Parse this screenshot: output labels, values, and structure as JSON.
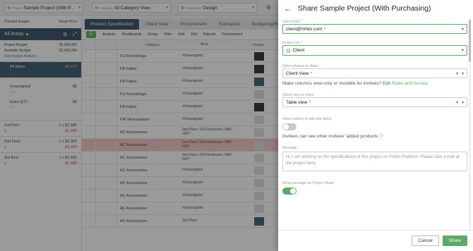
{
  "topbar": {
    "project_label": "Project",
    "project_value": "Sample Project (With P...",
    "category_label": "Category",
    "category_value": "All Category View",
    "dashboard_label": "Dashboard",
    "dashboard_value": "Design"
  },
  "left_panel": {
    "planned_budget": "Planned Budget",
    "retail_price": "Retail Price",
    "areas_title": "All Areas",
    "project_budget_label": "Project Budget",
    "project_budget_value": "$2,000,000",
    "available_budget_label": "Available Budget",
    "available_budget_value": "$1,995,295",
    "see_budget": "See Budget Analysis",
    "areas": [
      {
        "name": "All Items",
        "amount": "$6,473"
      },
      {
        "name": "Unassigned",
        "amount": "$0"
      },
      {
        "name": "Extra QTY",
        "amount": "$0"
      }
    ],
    "floors": [
      {
        "name": "1st Floor",
        "qty": "1 x $1,585",
        "total": "$1,585"
      },
      {
        "name": "2nd Floor",
        "qty": "1 x $3,305",
        "total": "$3,305"
      },
      {
        "name": "3rd floor",
        "qty": "1 x $1,585",
        "total": "$1,585"
      }
    ]
  },
  "main": {
    "tabs": [
      "Product Specification",
      "Client View",
      "Procurement",
      "Estimation",
      "Budgeting(Retail Pric"
    ],
    "toolbar": [
      "Analysis",
      "Moodboards",
      "Group",
      "Filter",
      "Add",
      "Edit",
      "Reports",
      "Procurement"
    ],
    "columns": {
      "category": "Category",
      "area": "Area",
      "images": "Images"
    },
    "rows": [
      {
        "category": "FU Furnishings",
        "area": "#Unassigned"
      },
      {
        "category": "FB Fabric",
        "area": "#Unassigned"
      },
      {
        "category": "FB Fabric",
        "area": "#Unassigned"
      },
      {
        "category": "FU Furnishings",
        "area": "#Unassigned"
      },
      {
        "category": "FB Fabric",
        "area": "#Unassigned"
      },
      {
        "category": "FW Workstations",
        "area": "#Unassigned"
      },
      {
        "category": "AC Accessories",
        "area": "2nd Floor / 202 Restroom / ABC #007"
      },
      {
        "category": "AC Accessories",
        "area": "2nd Floor / 202 Restroom / ABC #007"
      },
      {
        "category": "AC Accessories",
        "area": "2nd Floor / 202 Restroom / ABC #007"
      },
      {
        "category": "AC Accessories",
        "area": "#Unassigned"
      },
      {
        "category": "AC Accessories",
        "area": "#Unassigned"
      },
      {
        "category": "AC Accessories",
        "area": "#Unassigned"
      },
      {
        "category": "AC Accessories",
        "area": "#Unassigned"
      },
      {
        "category": "AC Accessories",
        "area": "2nd Floor"
      }
    ]
  },
  "dialog": {
    "title": "Share Sample Project (With Purchasing)",
    "email_label": "User email *",
    "email_value": "client@fohlio.com",
    "role_label": "Invitee role *",
    "role_value": "Client",
    "phases_label": "Select phases to share",
    "phases_value": "Client View",
    "phases_help": "Make columns view-only or invisible for invitees? Edit",
    "phases_link": "Roles and Access",
    "view_label": "Select view to share",
    "view_value": "Table view",
    "allow_label": "Allow invitees to add new items",
    "allow_help": "Invitees can see other invitees' added products",
    "message_label": "Message",
    "message_placeholder": "Hi, I am working on the specifications of this project on Fohlio Platform. Please take a look at the project here.",
    "show_message_label": "Show message on Project Sheet",
    "cancel": "Cancel",
    "share": "Share"
  }
}
